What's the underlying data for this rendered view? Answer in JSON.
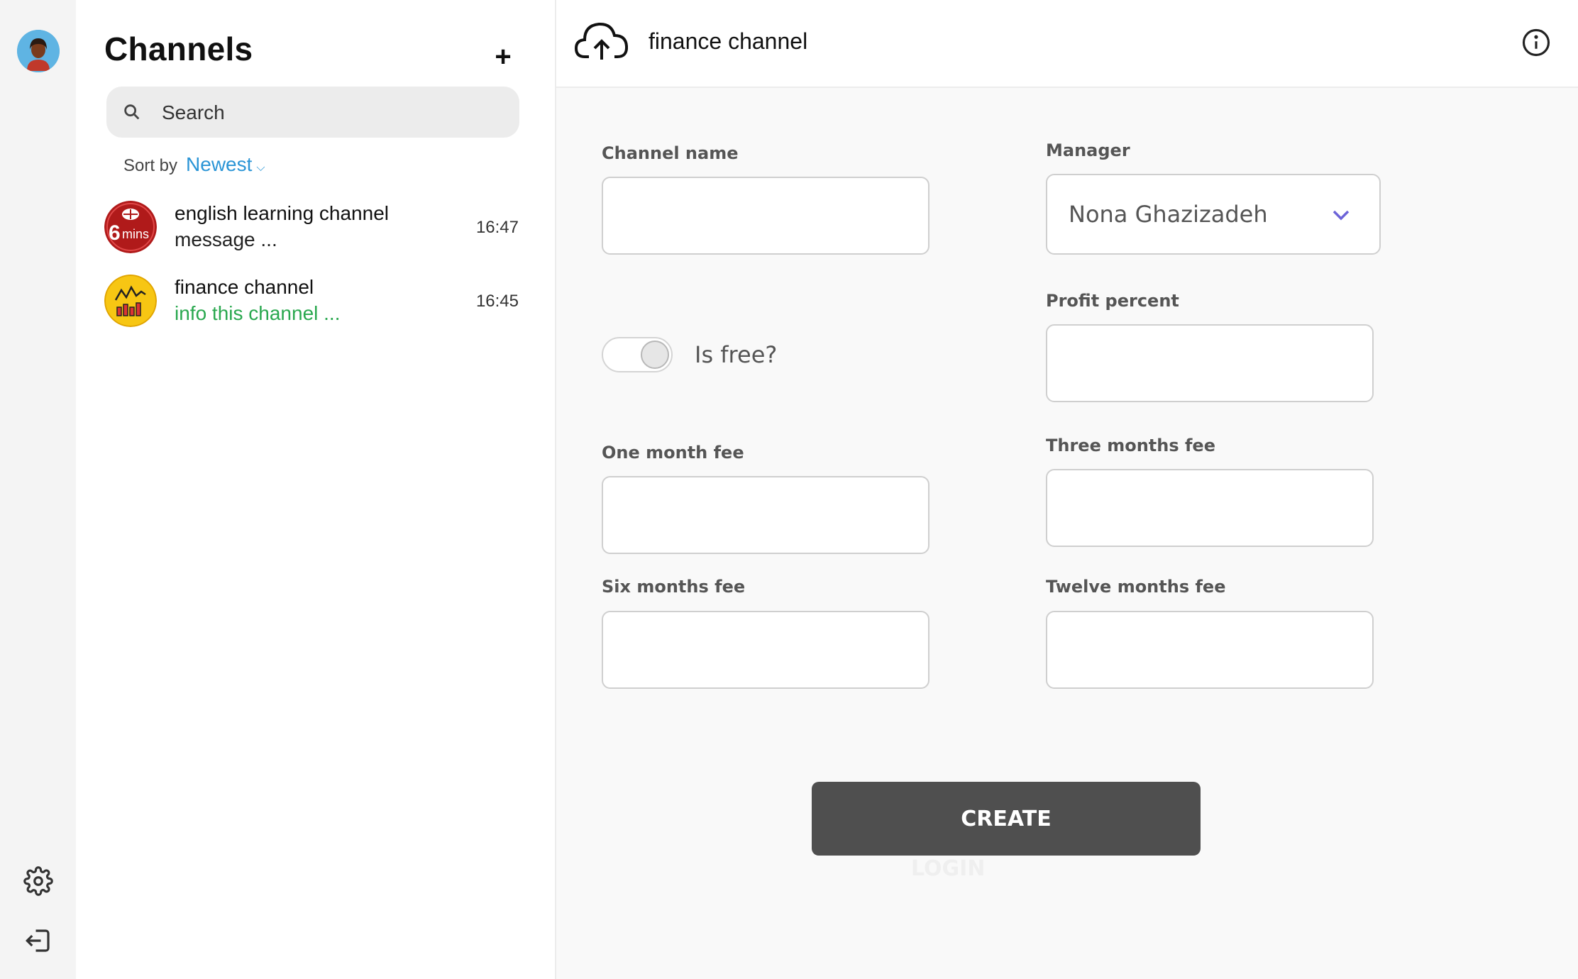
{
  "sidebar": {
    "icons": [
      "avatar",
      "gear-icon",
      "logout-icon"
    ]
  },
  "channels_panel": {
    "title": "Channels",
    "add_label": "+",
    "search": {
      "placeholder": "Search"
    },
    "sort": {
      "label": "Sort by",
      "value": "Newest"
    },
    "items": [
      {
        "name": "english learning channel",
        "preview": "message ...",
        "time": "16:47",
        "avatar_text": "6",
        "avatar_sub": "mins"
      },
      {
        "name": "finance channel",
        "preview": "info  this channel ...",
        "time": "16:45"
      }
    ]
  },
  "header": {
    "title": "finance channel"
  },
  "form": {
    "channel_name": {
      "label": "Channel name",
      "value": ""
    },
    "manager": {
      "label": "Manager",
      "value": "Nona Ghazizadeh"
    },
    "is_free": {
      "label": "Is free?",
      "checked": false
    },
    "profit_percent": {
      "label": "Profit percent",
      "value": ""
    },
    "one_month_fee": {
      "label": "One month fee",
      "value": ""
    },
    "three_months_fee": {
      "label": "Three months fee",
      "value": ""
    },
    "six_months_fee": {
      "label": "Six months fee",
      "value": ""
    },
    "twelve_months_fee": {
      "label": "Twelve months fee",
      "value": ""
    },
    "create_label": "CREATE",
    "ghost_label": "LOGIN"
  },
  "colors": {
    "accent_blue": "#2b95d6",
    "preview_green": "#2aa84f",
    "button_dark": "#4f4f4f",
    "chevron_purple": "#6c63d8"
  }
}
